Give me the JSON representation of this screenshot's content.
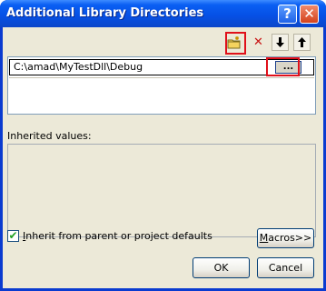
{
  "window": {
    "title": "Additional Library Directories",
    "help_glyph": "?",
    "close_glyph": "✕"
  },
  "toolbar": {
    "new_line_icon": "folder-new-icon",
    "delete_icon": "delete-x-icon",
    "move_down_glyph": "🡇",
    "move_up_glyph": "🡅",
    "delete_glyph": "✕"
  },
  "list": {
    "entries": [
      "C:\\amad\\MyTestDll\\Debug"
    ],
    "browse_label": "..."
  },
  "inherited": {
    "label": "Inherited values:"
  },
  "checkbox": {
    "label": "Inherit from parent or project defaults",
    "checked": true,
    "check_glyph": "✔"
  },
  "buttons": {
    "macros": "Macros>>",
    "ok": "OK",
    "cancel": "Cancel"
  },
  "colors": {
    "highlight": "#e0101a",
    "title_bar": "#0651e6",
    "dialog_bg": "#ece9d8"
  }
}
